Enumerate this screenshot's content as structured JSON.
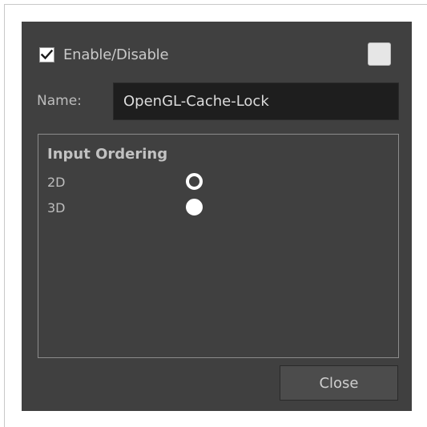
{
  "enable": {
    "label": "Enable/Disable",
    "checked": true
  },
  "swatch": {
    "color": "#e6e6e6"
  },
  "name": {
    "label": "Name:",
    "value": "OpenGL-Cache-Lock"
  },
  "input_ordering": {
    "title": "Input Ordering",
    "options": [
      {
        "label": "2D",
        "selected": true
      },
      {
        "label": "3D",
        "selected": false
      }
    ]
  },
  "buttons": {
    "close_label": "Close"
  },
  "colors": {
    "dialog_bg": "#404040",
    "field_bg": "#1e1e1e",
    "text": "#c9c9c9"
  }
}
